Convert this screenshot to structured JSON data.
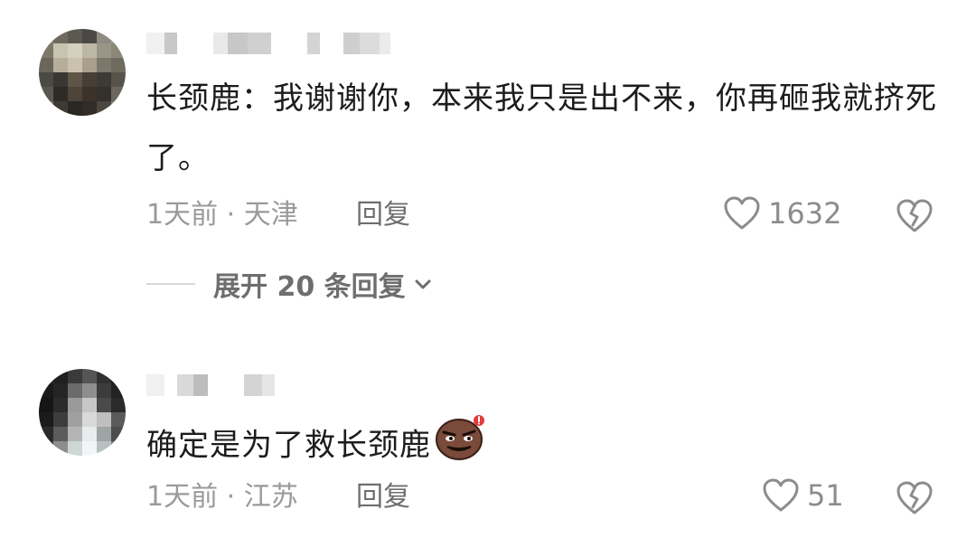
{
  "comments": [
    {
      "text": "长颈鹿：我谢谢你，本来我只是出不来，你再砸我就挤死了。",
      "time": "1天前 · 天津",
      "reply_label": "回复",
      "like_count": "1632",
      "expand_label": "展开 20 条回复"
    },
    {
      "text": "确定是为了救长颈鹿",
      "emoji": "smug-face-emoji",
      "time": "1天前 · 江苏",
      "reply_label": "回复",
      "like_count": "51"
    }
  ],
  "icons": {
    "like": "heart-outline-icon",
    "dislike": "broken-heart-icon",
    "expand": "chevron-down-icon"
  },
  "colors": {
    "text": "#1c1c1c",
    "meta": "#9a9a9a",
    "action": "#6e6e6e",
    "icon": "#8c8c8c"
  }
}
